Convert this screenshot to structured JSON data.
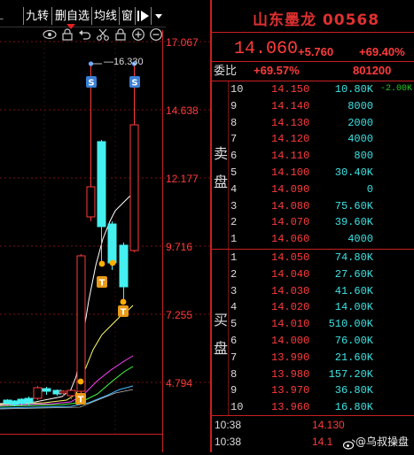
{
  "toolbar": {
    "buttons": [
      {
        "label": "九转"
      },
      {
        "label": "删自选"
      },
      {
        "label": "均线"
      },
      {
        "label": "窗"
      }
    ],
    "icons": [
      "eye-icon",
      "undo-icon",
      "scissors-icon",
      "lock-icon",
      "zoom-in-icon",
      "zoom-out-icon"
    ]
  },
  "stock": {
    "name_code": "山东墨龙 00568",
    "price": "14.060",
    "change": "+5.760",
    "change_pct": "+69.40%"
  },
  "weibi": {
    "label": "委比",
    "pct": "+69.57%",
    "diff": "801200"
  },
  "sell_label": [
    "卖",
    "盘"
  ],
  "buy_label": [
    "买",
    "盘"
  ],
  "sell_orders": [
    {
      "level": "10",
      "price": "14.150",
      "volume": "10.80K",
      "change": "-2.00K"
    },
    {
      "level": "9",
      "price": "14.140",
      "volume": "8000",
      "change": ""
    },
    {
      "level": "8",
      "price": "14.130",
      "volume": "2000",
      "change": ""
    },
    {
      "level": "7",
      "price": "14.120",
      "volume": "4000",
      "change": ""
    },
    {
      "level": "6",
      "price": "14.110",
      "volume": "800",
      "change": ""
    },
    {
      "level": "5",
      "price": "14.100",
      "volume": "30.40K",
      "change": ""
    },
    {
      "level": "4",
      "price": "14.090",
      "volume": "0",
      "change": ""
    },
    {
      "level": "3",
      "price": "14.080",
      "volume": "75.60K",
      "change": ""
    },
    {
      "level": "2",
      "price": "14.070",
      "volume": "39.60K",
      "change": ""
    },
    {
      "level": "1",
      "price": "14.060",
      "volume": "4000",
      "change": ""
    }
  ],
  "buy_orders": [
    {
      "level": "1",
      "price": "14.050",
      "volume": "74.80K"
    },
    {
      "level": "2",
      "price": "14.040",
      "volume": "27.60K"
    },
    {
      "level": "3",
      "price": "14.030",
      "volume": "41.60K"
    },
    {
      "level": "4",
      "price": "14.020",
      "volume": "14.00K"
    },
    {
      "level": "5",
      "price": "14.010",
      "volume": "510.00K"
    },
    {
      "level": "6",
      "price": "14.000",
      "volume": "76.00K"
    },
    {
      "level": "7",
      "price": "13.990",
      "volume": "21.60K"
    },
    {
      "level": "8",
      "price": "13.980",
      "volume": "157.20K"
    },
    {
      "level": "9",
      "price": "13.970",
      "volume": "36.80K"
    },
    {
      "level": "10",
      "price": "13.960",
      "volume": "16.80K"
    }
  ],
  "ticks": [
    {
      "time": "10:38",
      "price": "14.130"
    },
    {
      "time": "10:38",
      "price": "14.1"
    }
  ],
  "watermark": "@乌叔操盘",
  "chart_data": {
    "type": "candlestick",
    "y_axis_labels": [
      "17.067",
      "14.638",
      "12.177",
      "9.716",
      "7.255",
      "4.794"
    ],
    "ylim": [
      3.5,
      17.8
    ],
    "high_annotation": "16.330",
    "markers": [
      "S",
      "S",
      "T",
      "T",
      "T"
    ],
    "colors": {
      "up": "#ff3b3b",
      "down": "#44f0f0",
      "ma5": "#ffffff",
      "ma10": "#ffff66",
      "ma20": "#ff44ff",
      "ma30": "#44ff44",
      "ma60": "#44bbff"
    }
  }
}
